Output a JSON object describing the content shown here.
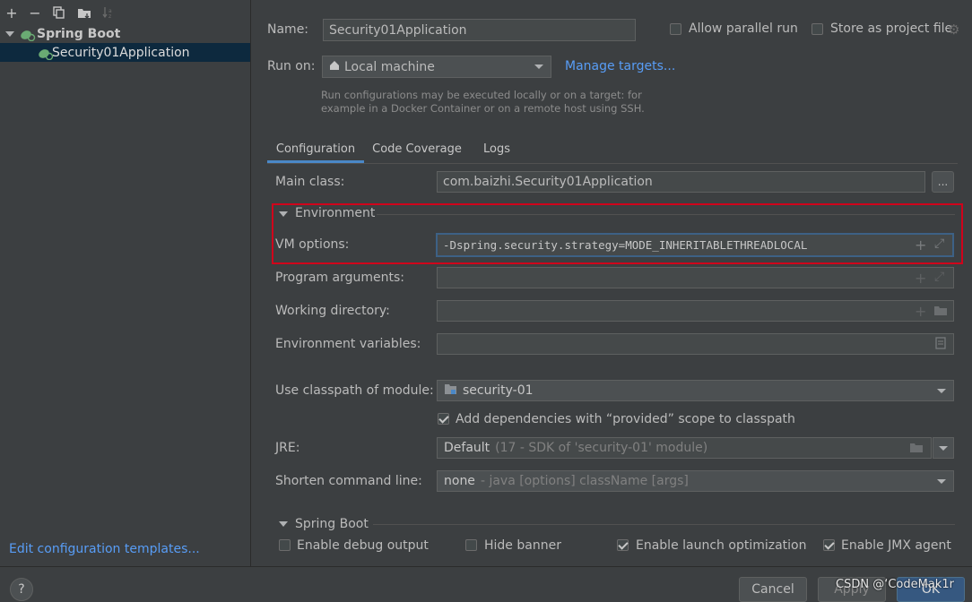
{
  "sidebar": {
    "toolbar": [
      "add-icon",
      "remove-icon",
      "copy-icon",
      "folder-icon",
      "sort-icon"
    ],
    "tree": {
      "group_label": "Spring Boot",
      "item_label": "Security01Application"
    },
    "edit_templates_link": "Edit configuration templates..."
  },
  "header": {
    "name_label": "Name:",
    "name_value": "Security01Application",
    "allow_parallel_label": "Allow parallel run",
    "store_label": "Store as project file",
    "run_on_label": "Run on:",
    "run_on_value": "Local machine",
    "manage_targets": "Manage targets...",
    "hint_line1": "Run configurations may be executed locally or on a target: for",
    "hint_line2": "example in a Docker Container or on a remote host using SSH."
  },
  "tabs": [
    "Configuration",
    "Code Coverage",
    "Logs"
  ],
  "form": {
    "main_class_label": "Main class:",
    "main_class_value": "com.baizhi.Security01Application",
    "main_class_btn": "...",
    "environment_label": "Environment",
    "vm_options_label": "VM options:",
    "vm_options_value": "-Dspring.security.strategy=MODE_INHERITABLETHREADLOCAL",
    "program_args_label": "Program arguments:",
    "working_dir_label": "Working directory:",
    "env_vars_label": "Environment variables:",
    "classpath_label": "Use classpath of module:",
    "classpath_value": "security-01",
    "add_deps_label": "Add dependencies with “provided” scope to classpath",
    "jre_label": "JRE:",
    "jre_value": "Default",
    "jre_hint": "(17 - SDK of 'security-01' module)",
    "shorten_label": "Shorten command line:",
    "shorten_value": "none",
    "shorten_hint": "- java [options] className [args]",
    "spring_boot_label": "Spring Boot",
    "enable_debug": "Enable debug output",
    "hide_banner": "Hide banner",
    "enable_launch": "Enable launch optimization",
    "enable_jmx": "Enable JMX agent"
  },
  "footer": {
    "help": "?",
    "cancel": "Cancel",
    "apply": "Apply",
    "ok": "OK",
    "watermark": "CSDN @‘CodeMak1r"
  },
  "colors": {
    "highlight_box": "#d0021b",
    "accent": "#589df6"
  }
}
